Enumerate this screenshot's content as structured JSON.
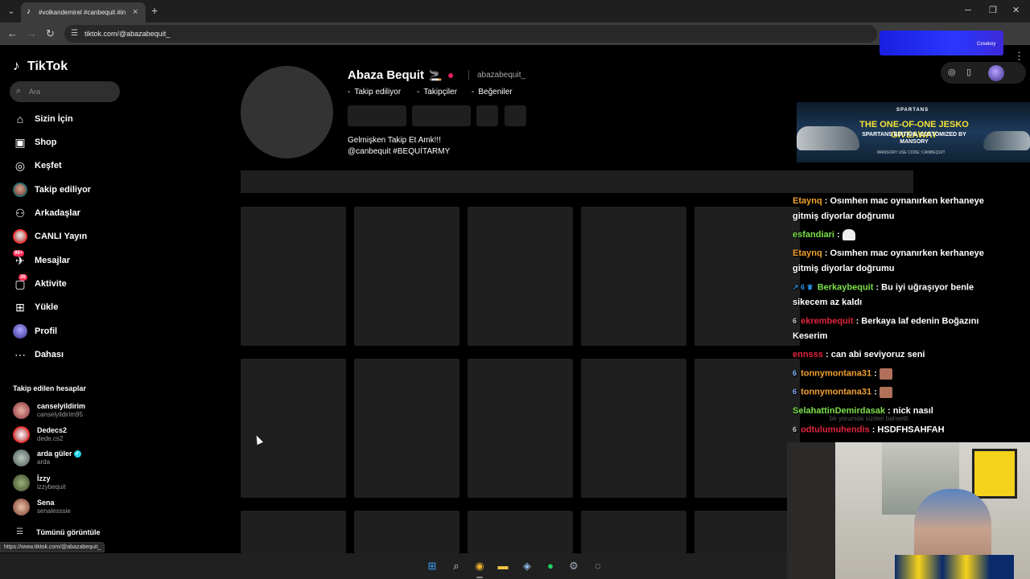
{
  "browser": {
    "tab_title": "#volkandemirel #canbequit #in",
    "tab_favicon": "tiktok-icon",
    "new_tab": "+",
    "tab_close": "×",
    "url": "tiktok.com/@abazabequit_",
    "overlay_text": "Cosekoy",
    "status_url": "https://www.tiktok.com/@abazabequit_"
  },
  "sidebar": {
    "logo": "TikTok",
    "search_placeholder": "Ara",
    "nav": [
      {
        "label": "Sizin İçin",
        "icon": "home-icon"
      },
      {
        "label": "Shop",
        "icon": "shopping-bag-icon"
      },
      {
        "label": "Keşfet",
        "icon": "compass-icon"
      },
      {
        "label": "Takip ediliyor",
        "icon": "following-avatar-icon"
      },
      {
        "label": "Arkadaşlar",
        "icon": "friends-icon"
      },
      {
        "label": "CANLI Yayın",
        "icon": "live-icon"
      },
      {
        "label": "Mesajlar",
        "icon": "messages-icon",
        "badge": "99+"
      },
      {
        "label": "Aktivite",
        "icon": "activity-icon",
        "badge": "26"
      },
      {
        "label": "Yükle",
        "icon": "upload-icon"
      },
      {
        "label": "Profil",
        "icon": "profile-avatar-icon"
      },
      {
        "label": "Dahası",
        "icon": "more-icon"
      }
    ],
    "following_header": "Takip edilen hesaplar",
    "accounts": [
      {
        "name": "canselyildirim",
        "handle": "canselyildirim95",
        "color": "#c45a6e"
      },
      {
        "name": "Dedecs2",
        "handle": "dede.cs2",
        "color": "#d9d9d9"
      },
      {
        "name": "arda güler",
        "handle": "arda",
        "color": "#6c7a68",
        "verified": true
      },
      {
        "name": "İzzy",
        "handle": "izzybequit",
        "color": "#556b3f"
      },
      {
        "name": "Sena",
        "handle": "senalesssie",
        "color": "#a45a4a"
      }
    ],
    "see_all": "Tümünü görüntüle"
  },
  "profile": {
    "name": "Abaza Bequit",
    "handle": "abazabequit_",
    "stats": [
      "Takip ediliyor",
      "Takipçiler",
      "Beğeniler"
    ],
    "stat_prefix": "-",
    "bio_line1": "Gelmişken Takip Et Amk!!!",
    "bio_line2": "@canbequit #BEQUİTARMY"
  },
  "ad": {
    "brand": "SPARTANS",
    "title": "THE ONE-OF-ONE JESKO GIVEAWAY",
    "subtitle": "SPARTANS EDITION. CUSTOMIZED BY MANSORY",
    "footer": "MANSORY          USE CODE: CANBEQUIT"
  },
  "chat": [
    {
      "user": "Etaynq",
      "color": "#f0a030",
      "badges": "",
      "message": ": Osımhen mac oynanırken kerhaneye gitmiş diyorlar doğrumu",
      "emote": ""
    },
    {
      "user": "esfandiari",
      "color": "#7ce04a",
      "badges": "",
      "message": ":",
      "emote": "ghost"
    },
    {
      "user": "Etaynq",
      "color": "#f0a030",
      "badges": "",
      "message": ": Osımhen mac oynanırken kerhaneye gitmiş diyorlar doğrumu",
      "emote": ""
    },
    {
      "user": "Berkaybequit",
      "color": "#7ce04a",
      "badges": "↗ 6 ♛",
      "message": ": Bu iyi uğraşıyor benle sikecem az kaldı",
      "emote": ""
    },
    {
      "user": "ekrembequit",
      "color": "#e0253c",
      "badges": "6",
      "message": ": Berkaya laf edenin Boğazını Keserim",
      "emote": ""
    },
    {
      "user": "ennsss",
      "color": "#e0253c",
      "badges": "",
      "message": ": can abi seviyoruz seni",
      "emote": ""
    },
    {
      "user": "tonnymontana31",
      "color": "#f0a030",
      "badges": "6",
      "message": ":",
      "emote": "face"
    },
    {
      "user": "tonnymontana31",
      "color": "#f0a030",
      "badges": "6",
      "message": ":",
      "emote": "face"
    },
    {
      "user": "SelahattinDemirdasak",
      "color": "#7ce04a",
      "badges": "",
      "message": ": nick nasıl",
      "emote": ""
    },
    {
      "user": "odtulumuhendis",
      "color": "#e0253c",
      "badges": "6",
      "message": ": HSDFHSAHFAH",
      "emote": ""
    }
  ],
  "chat_ghost_text": "bir yorumda sizden bahsetti"
}
